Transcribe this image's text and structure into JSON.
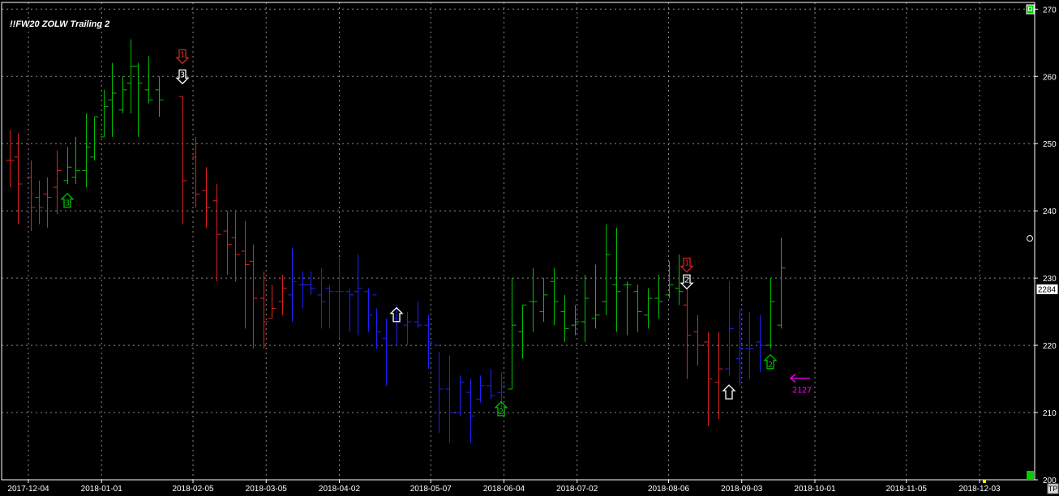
{
  "chart_data": {
    "type": "bar",
    "title": "!!FW20 ZOLW Trailing 2",
    "ylim": [
      200,
      271
    ],
    "y_ticks": [
      200,
      210,
      220,
      230,
      240,
      250,
      260,
      270
    ],
    "x_ticks": [
      "2017-12-04",
      "2018-01-01",
      "2018-02-05",
      "2018-03-05",
      "2018-04-02",
      "2018-05-07",
      "2018-06-04",
      "2018-07-02",
      "2018-08-06",
      "2018-09-03",
      "2018-10-01",
      "2018-11-05",
      "2018-12-03"
    ],
    "grid": true,
    "last_price_label": "2284",
    "last_price_value": 228.4,
    "colors": {
      "background": "#000000",
      "up_trend": "#00c000",
      "down_trend": "#e02020",
      "neutral": "#2020ff",
      "grid": "#8a8a8a",
      "axis": "#ffffff",
      "target": "#ff00ff",
      "price_box": "#ffffff"
    },
    "ohlc_bars": [
      {
        "date": "2017-11-27",
        "open": 247.5,
        "high": 252.0,
        "low": 243.5,
        "close": 247.5,
        "trend": "down"
      },
      {
        "date": "2017-11-30",
        "open": 248.0,
        "high": 251.5,
        "low": 238.0,
        "close": 244.0,
        "trend": "down"
      },
      {
        "date": "2017-12-05",
        "open": 245.0,
        "high": 247.5,
        "low": 237.0,
        "close": 240.5,
        "trend": "down"
      },
      {
        "date": "2017-12-08",
        "open": 242.0,
        "high": 244.5,
        "low": 238.0,
        "close": 240.5,
        "trend": "down"
      },
      {
        "date": "2017-12-11",
        "open": 242.5,
        "high": 245.0,
        "low": 237.5,
        "close": 242.0,
        "trend": "down"
      },
      {
        "date": "2017-12-15",
        "open": 243.5,
        "high": 249.0,
        "low": 239.5,
        "close": 246.0,
        "trend": "down"
      },
      {
        "date": "2017-12-19",
        "open": 244.5,
        "high": 249.5,
        "low": 244.0,
        "close": 246.5,
        "trend": "up"
      },
      {
        "date": "2017-12-22",
        "open": 245.0,
        "high": 251.0,
        "low": 244.0,
        "close": 246.0,
        "trend": "up"
      },
      {
        "date": "2017-12-26",
        "open": 246.0,
        "high": 254.5,
        "low": 243.5,
        "close": 249.5,
        "trend": "up"
      },
      {
        "date": "2017-12-29",
        "open": 248.0,
        "high": 254.0,
        "low": 247.5,
        "close": 254.0,
        "trend": "up"
      },
      {
        "date": "2018-01-02",
        "open": 251.0,
        "high": 258.0,
        "low": 251.0,
        "close": 255.5,
        "trend": "up"
      },
      {
        "date": "2018-01-05",
        "open": 256.5,
        "high": 262.0,
        "low": 251.0,
        "close": 257.5,
        "trend": "up"
      },
      {
        "date": "2018-01-09",
        "open": 255.0,
        "high": 260.0,
        "low": 254.5,
        "close": 258.0,
        "trend": "up"
      },
      {
        "date": "2018-01-12",
        "open": 259.0,
        "high": 265.5,
        "low": 254.5,
        "close": 261.5,
        "trend": "up"
      },
      {
        "date": "2018-01-15",
        "open": 261.5,
        "high": 262.0,
        "low": 251.0,
        "close": 259.0,
        "trend": "up"
      },
      {
        "date": "2018-01-19",
        "open": 258.0,
        "high": 263.0,
        "low": 256.0,
        "close": 256.5,
        "trend": "up"
      },
      {
        "date": "2018-01-23",
        "open": 258.0,
        "high": 260.0,
        "low": 254.0,
        "close": 256.5,
        "trend": "up"
      },
      {
        "date": "2018-02-01",
        "open": 257.0,
        "high": 257.0,
        "low": 238.0,
        "close": 244.5,
        "trend": "down"
      },
      {
        "date": "2018-02-06",
        "open": 248.0,
        "high": 251.0,
        "low": 240.5,
        "close": 242.5,
        "trend": "down"
      },
      {
        "date": "2018-02-10",
        "open": 243.0,
        "high": 246.5,
        "low": 237.5,
        "close": 240.5,
        "trend": "down"
      },
      {
        "date": "2018-02-14",
        "open": 241.5,
        "high": 244.0,
        "low": 229.5,
        "close": 236.5,
        "trend": "down"
      },
      {
        "date": "2018-02-18",
        "open": 237.0,
        "high": 240.0,
        "low": 230.5,
        "close": 235.0,
        "trend": "down"
      },
      {
        "date": "2018-02-21",
        "open": 236.0,
        "high": 240.0,
        "low": 229.5,
        "close": 233.5,
        "trend": "down"
      },
      {
        "date": "2018-02-25",
        "open": 234.0,
        "high": 238.5,
        "low": 222.5,
        "close": 232.0,
        "trend": "down"
      },
      {
        "date": "2018-02-28",
        "open": 232.5,
        "high": 235.0,
        "low": 219.5,
        "close": 227.0,
        "trend": "down"
      },
      {
        "date": "2018-03-04",
        "open": 227.0,
        "high": 231.0,
        "low": 219.5,
        "close": 223.5,
        "trend": "down"
      },
      {
        "date": "2018-03-07",
        "open": 224.0,
        "high": 229.0,
        "low": 224.0,
        "close": 225.5,
        "trend": "down"
      },
      {
        "date": "2018-03-11",
        "open": 226.5,
        "high": 230.5,
        "low": 224.5,
        "close": 228.5,
        "trend": "down"
      },
      {
        "date": "2018-03-15",
        "open": 227.5,
        "high": 234.5,
        "low": 223.5,
        "close": 229.5,
        "trend": "neutral"
      },
      {
        "date": "2018-03-19",
        "open": 229.0,
        "high": 231.0,
        "low": 225.5,
        "close": 229.0,
        "trend": "neutral"
      },
      {
        "date": "2018-03-22",
        "open": 229.0,
        "high": 231.0,
        "low": 227.5,
        "close": 228.5,
        "trend": "neutral"
      },
      {
        "date": "2018-03-26",
        "open": 227.5,
        "high": 231.5,
        "low": 222.5,
        "close": 226.5,
        "trend": "neutral"
      },
      {
        "date": "2018-03-29",
        "open": 228.5,
        "high": 229.0,
        "low": 222.5,
        "close": 228.0,
        "trend": "neutral"
      },
      {
        "date": "2018-04-02",
        "open": 228.0,
        "high": 233.0,
        "low": 221.0,
        "close": 228.0,
        "trend": "neutral"
      },
      {
        "date": "2018-04-06",
        "open": 228.0,
        "high": 228.5,
        "low": 222.0,
        "close": 227.5,
        "trend": "neutral"
      },
      {
        "date": "2018-04-09",
        "open": 228.0,
        "high": 233.5,
        "low": 221.5,
        "close": 228.5,
        "trend": "neutral"
      },
      {
        "date": "2018-04-13",
        "open": 228.0,
        "high": 228.5,
        "low": 222.0,
        "close": 224.5,
        "trend": "neutral"
      },
      {
        "date": "2018-04-16",
        "open": 227.5,
        "high": 225.5,
        "low": 219.5,
        "close": 222.0,
        "trend": "neutral"
      },
      {
        "date": "2018-04-20",
        "open": 221.0,
        "high": 224.0,
        "low": 214.0,
        "close": 220.0,
        "trend": "neutral"
      },
      {
        "date": "2018-04-24",
        "open": 224.0,
        "high": 226.0,
        "low": 220.0,
        "close": 223.5,
        "trend": "neutral"
      },
      {
        "date": "2018-04-28",
        "open": 223.0,
        "high": 225.0,
        "low": 220.0,
        "close": 223.5,
        "trend": "neutral"
      },
      {
        "date": "2018-05-02",
        "open": 223.5,
        "high": 226.5,
        "low": 222.5,
        "close": 223.0,
        "trend": "neutral"
      },
      {
        "date": "2018-05-06",
        "open": 223.0,
        "high": 224.5,
        "low": 216.5,
        "close": 220.5,
        "trend": "neutral"
      },
      {
        "date": "2018-05-10",
        "open": 220.0,
        "high": 219.0,
        "low": 207.0,
        "close": 213.5,
        "trend": "neutral"
      },
      {
        "date": "2018-05-14",
        "open": 213.5,
        "high": 218.5,
        "low": 205.5,
        "close": 210.0,
        "trend": "neutral"
      },
      {
        "date": "2018-05-18",
        "open": 210.0,
        "high": 215.5,
        "low": 209.5,
        "close": 214.5,
        "trend": "neutral"
      },
      {
        "date": "2018-05-22",
        "open": 213.0,
        "high": 215.0,
        "low": 205.5,
        "close": 209.5,
        "trend": "neutral"
      },
      {
        "date": "2018-05-26",
        "open": 212.0,
        "high": 215.5,
        "low": 211.5,
        "close": 214.0,
        "trend": "neutral"
      },
      {
        "date": "2018-05-30",
        "open": 214.0,
        "high": 216.5,
        "low": 212.0,
        "close": 212.5,
        "trend": "neutral"
      },
      {
        "date": "2018-06-03",
        "open": 213.0,
        "high": 216.0,
        "low": 210.5,
        "close": 214.0,
        "trend": "neutral"
      },
      {
        "date": "2018-06-07",
        "open": 213.5,
        "high": 230.0,
        "low": 213.5,
        "close": 223.0,
        "trend": "up"
      },
      {
        "date": "2018-06-11",
        "open": 222.0,
        "high": 226.0,
        "low": 218.0,
        "close": 226.0,
        "trend": "up"
      },
      {
        "date": "2018-06-15",
        "open": 226.5,
        "high": 231.5,
        "low": 222.0,
        "close": 226.5,
        "trend": "up"
      },
      {
        "date": "2018-06-19",
        "open": 225.0,
        "high": 230.0,
        "low": 223.5,
        "close": 227.5,
        "trend": "up"
      },
      {
        "date": "2018-06-23",
        "open": 229.5,
        "high": 231.5,
        "low": 223.0,
        "close": 226.5,
        "trend": "up"
      },
      {
        "date": "2018-06-27",
        "open": 225.0,
        "high": 227.5,
        "low": 220.5,
        "close": 222.5,
        "trend": "up"
      },
      {
        "date": "2018-07-01",
        "open": 223.0,
        "high": 226.0,
        "low": 221.5,
        "close": 223.5,
        "trend": "up"
      },
      {
        "date": "2018-07-05",
        "open": 223.5,
        "high": 230.5,
        "low": 220.5,
        "close": 227.0,
        "trend": "up"
      },
      {
        "date": "2018-07-09",
        "open": 224.0,
        "high": 232.0,
        "low": 222.5,
        "close": 224.5,
        "trend": "up"
      },
      {
        "date": "2018-07-13",
        "open": 226.5,
        "high": 238.0,
        "low": 224.5,
        "close": 233.5,
        "trend": "up"
      },
      {
        "date": "2018-07-17",
        "open": 229.0,
        "high": 237.5,
        "low": 222.0,
        "close": 228.0,
        "trend": "up"
      },
      {
        "date": "2018-07-21",
        "open": 229.0,
        "high": 229.5,
        "low": 221.5,
        "close": 229.0,
        "trend": "up"
      },
      {
        "date": "2018-07-25",
        "open": 228.0,
        "high": 229.0,
        "low": 222.0,
        "close": 225.0,
        "trend": "up"
      },
      {
        "date": "2018-07-29",
        "open": 224.5,
        "high": 228.5,
        "low": 222.5,
        "close": 227.0,
        "trend": "up"
      },
      {
        "date": "2018-08-02",
        "open": 227.0,
        "high": 230.5,
        "low": 224.0,
        "close": 226.5,
        "trend": "up"
      },
      {
        "date": "2018-08-06",
        "open": 227.5,
        "high": 232.5,
        "low": 227.0,
        "close": 229.0,
        "trend": "up"
      },
      {
        "date": "2018-08-10",
        "open": 228.5,
        "high": 233.5,
        "low": 226.0,
        "close": 228.0,
        "trend": "up"
      },
      {
        "date": "2018-08-13",
        "open": 226.0,
        "high": 228.5,
        "low": 215.0,
        "close": 221.5,
        "trend": "down"
      },
      {
        "date": "2018-08-17",
        "open": 222.0,
        "high": 224.5,
        "low": 217.0,
        "close": 220.0,
        "trend": "down"
      },
      {
        "date": "2018-08-21",
        "open": 220.5,
        "high": 222.0,
        "low": 208.0,
        "close": 215.0,
        "trend": "down"
      },
      {
        "date": "2018-08-25",
        "open": 214.5,
        "high": 222.0,
        "low": 209.0,
        "close": 216.5,
        "trend": "down"
      },
      {
        "date": "2018-08-29",
        "open": 216.5,
        "high": 229.5,
        "low": 215.5,
        "close": 222.5,
        "trend": "neutral"
      },
      {
        "date": "2018-09-02",
        "open": 218.0,
        "high": 225.5,
        "low": 214.0,
        "close": 219.5,
        "trend": "neutral"
      },
      {
        "date": "2018-09-06",
        "open": 219.5,
        "high": 225.0,
        "low": 215.0,
        "close": 219.5,
        "trend": "neutral"
      },
      {
        "date": "2018-09-10",
        "open": 220.5,
        "high": 224.5,
        "low": 216.0,
        "close": 220.0,
        "trend": "neutral"
      },
      {
        "date": "2018-09-14",
        "open": 220.0,
        "high": 230.0,
        "low": 219.5,
        "close": 226.5,
        "trend": "up"
      },
      {
        "date": "2018-09-18",
        "open": 223.0,
        "high": 236.0,
        "low": 222.5,
        "close": 231.5,
        "trend": "up"
      }
    ],
    "signal_markers": [
      {
        "date": "2017-12-19",
        "price": 241.5,
        "direction": "up",
        "label": "3",
        "color": "#00c000"
      },
      {
        "date": "2018-02-01",
        "price": 263.0,
        "direction": "down",
        "label": "1",
        "color": "#e02020"
      },
      {
        "date": "2018-02-01",
        "price": 260.0,
        "direction": "down",
        "label": "3",
        "color": "#ffffff"
      },
      {
        "date": "2018-04-24",
        "price": 224.5,
        "direction": "up",
        "label": "",
        "color": "#ffffff"
      },
      {
        "date": "2018-06-03",
        "price": 210.5,
        "direction": "up",
        "label": "2",
        "color": "#00c000"
      },
      {
        "date": "2018-08-13",
        "price": 232.0,
        "direction": "down",
        "label": "1",
        "color": "#e02020"
      },
      {
        "date": "2018-08-13",
        "price": 229.5,
        "direction": "down",
        "label": "2",
        "color": "#ffffff"
      },
      {
        "date": "2018-08-29",
        "price": 213.0,
        "direction": "up",
        "label": "",
        "color": "#ffffff"
      },
      {
        "date": "2018-09-14",
        "price": 217.5,
        "direction": "up",
        "label": "2",
        "color": "#00c000"
      }
    ],
    "target": {
      "label": "2127",
      "price": 212.7,
      "arrow": "left",
      "color": "#ff00ff"
    },
    "corner_label": "TP"
  }
}
